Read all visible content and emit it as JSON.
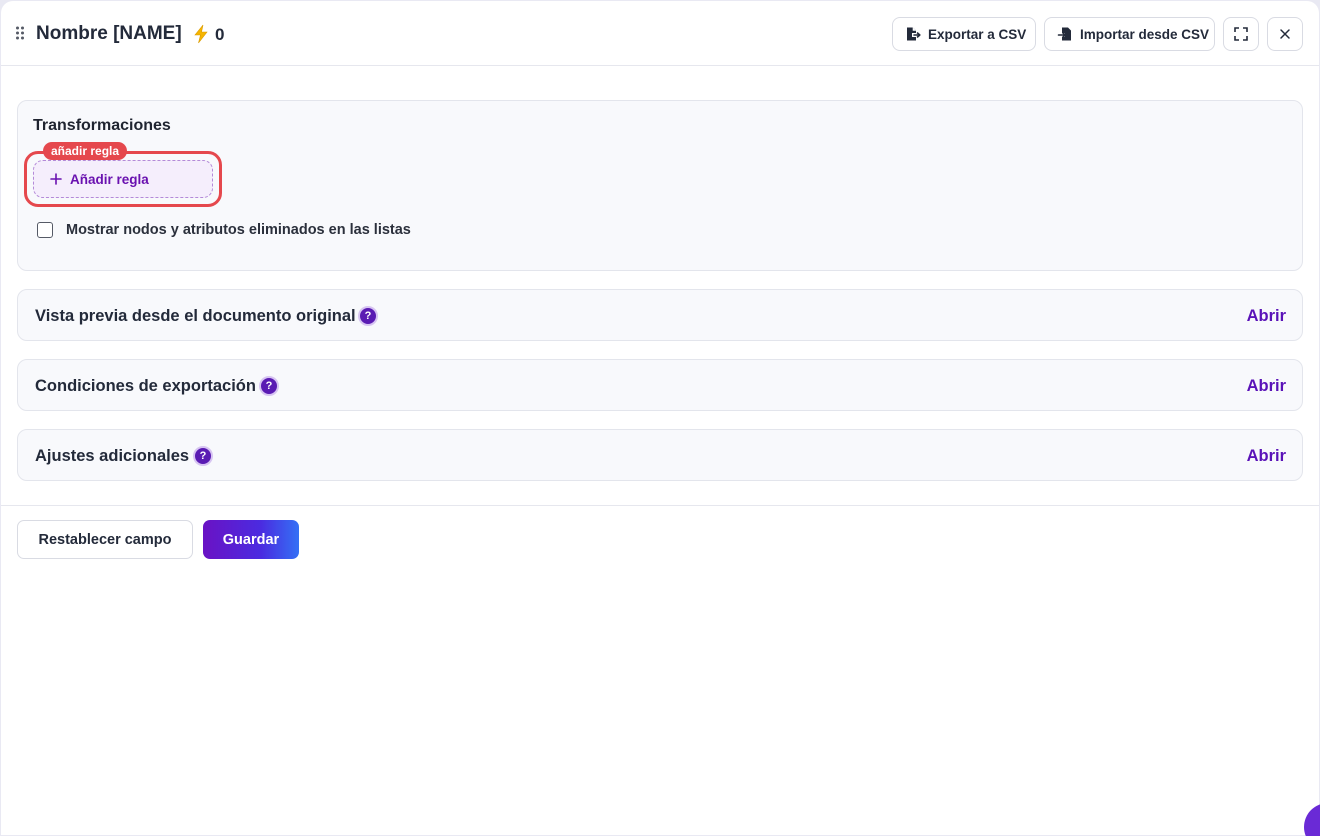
{
  "header": {
    "title": "Nombre [NAME]",
    "count": "0",
    "export_label": "Exportar a CSV",
    "import_label": "Importar desde CSV",
    "icons": {
      "drag": "drag-handle-icon",
      "bolt": "lightning-bolt-icon",
      "export": "file-export-icon",
      "import": "file-import-icon",
      "fullscreen": "fullscreen-icon",
      "close": "close-icon"
    }
  },
  "transformations": {
    "title": "Transformaciones",
    "highlight_tag": "añadir regla",
    "add_rule_label": "Añadir regla",
    "show_deleted_label": "Mostrar nodos y atributos eliminados en las listas",
    "show_deleted_checked": false
  },
  "sections": [
    {
      "title": "Vista previa desde el documento original",
      "help": "?",
      "action": "Abrir"
    },
    {
      "title": "Condiciones de exportación",
      "help": "?",
      "action": "Abrir"
    },
    {
      "title": "Ajustes adicionales",
      "help": "?",
      "action": "Abrir"
    }
  ],
  "footer": {
    "reset_label": "Restablecer campo",
    "save_label": "Guardar"
  },
  "colors": {
    "accent": "#5a12b8",
    "highlight": "#e5484d",
    "bolt": "#f5b400"
  }
}
